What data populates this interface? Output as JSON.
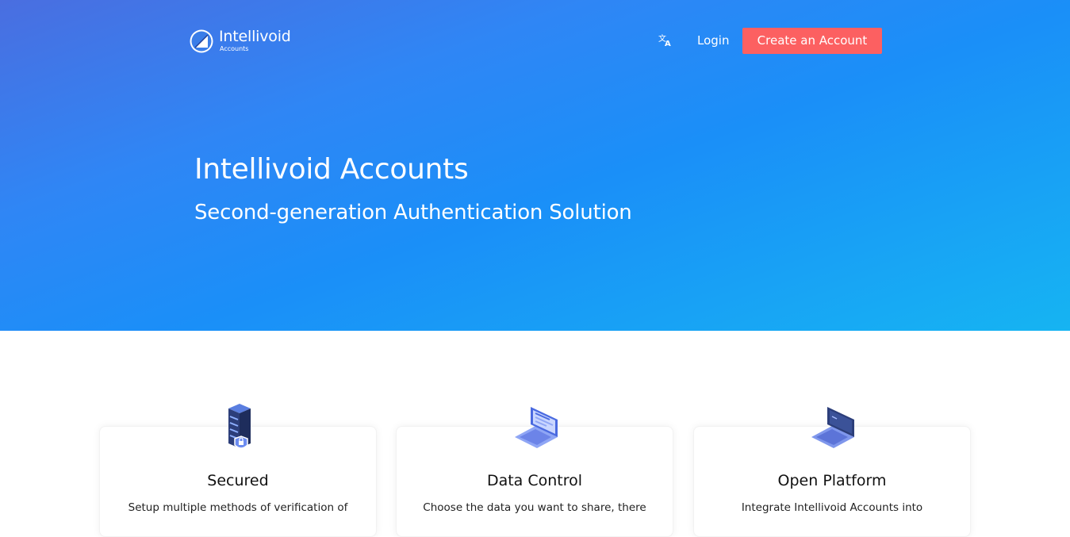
{
  "header": {
    "brand_name": "Intellivoid",
    "brand_sub": "Accounts",
    "login_label": "Login",
    "create_account_label": "Create an Account",
    "lang_icon": "translate-icon"
  },
  "hero": {
    "title": "Intellivoid Accounts",
    "subtitle": "Second-generation Authentication Solution"
  },
  "features": [
    {
      "title": "Secured",
      "description": "Setup multiple methods of verification of",
      "icon": "server-lock-icon"
    },
    {
      "title": "Data Control",
      "description": "Choose the data you want to share, there",
      "icon": "laptop-data-icon"
    },
    {
      "title": "Open Platform",
      "description": "Integrate Intellivoid Accounts into",
      "icon": "laptop-code-icon"
    }
  ],
  "colors": {
    "accent": "#fc6061",
    "hero_gradient_start": "#4a6ee0",
    "hero_gradient_end": "#16b4f2"
  }
}
